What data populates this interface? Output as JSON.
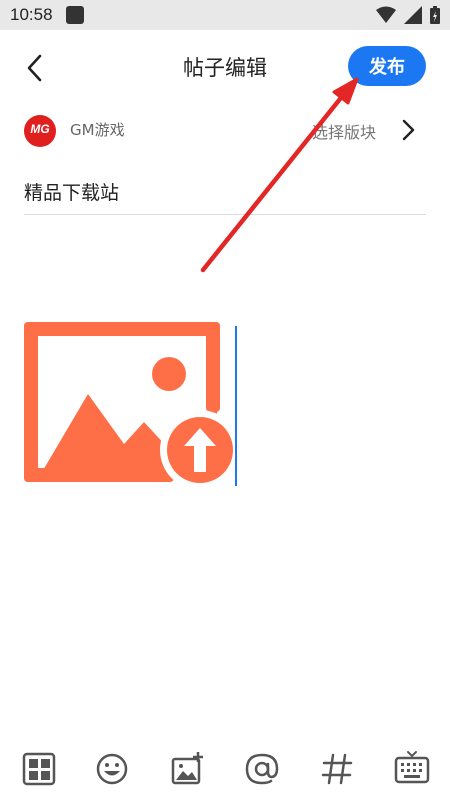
{
  "status_bar": {
    "time": "10:58"
  },
  "header": {
    "title": "帖子编辑",
    "publish_label": "发布"
  },
  "forum": {
    "logo_text": "MG",
    "name": "GM游戏",
    "select_label": "选择版块"
  },
  "post": {
    "title_value": "精品下载站"
  },
  "colors": {
    "accent": "#1b78f2",
    "image_placeholder": "#ff6f47",
    "annotation_arrow": "#e32626"
  },
  "toolbar": {
    "icons": [
      "grid-icon",
      "emoji-icon",
      "add-image-icon",
      "at-icon",
      "hashtag-icon",
      "keyboard-icon"
    ]
  }
}
